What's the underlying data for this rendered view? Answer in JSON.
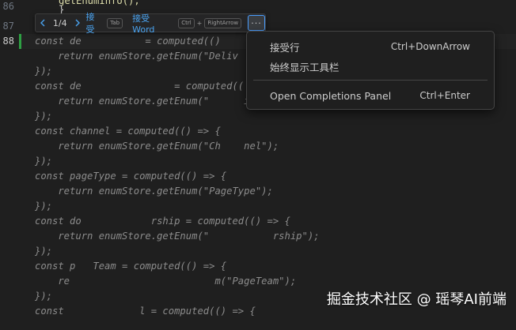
{
  "gutter": {
    "line_numbers": [
      "86",
      "87",
      "88"
    ]
  },
  "top_fragment": {
    "line1": "getEnumInfo();",
    "line2": "}"
  },
  "toolbar": {
    "prev_icon": "chevron-left-icon",
    "next_icon": "chevron-right-icon",
    "counter": "1/4",
    "accept_label": "接受",
    "accept_key": "Tab",
    "accept_word_label": "接受 Word",
    "accept_word_key1": "Ctrl",
    "accept_word_plus": "+",
    "accept_word_key2": "RightArrow",
    "more_label": "···"
  },
  "menu": {
    "items": [
      {
        "label": "接受行",
        "shortcut": "Ctrl+DownArrow"
      },
      {
        "label": "始终显示工具栏",
        "shortcut": ""
      },
      {
        "label": "Open Completions Panel",
        "shortcut": "Ctrl+Enter"
      }
    ]
  },
  "code": {
    "lines": [
      "const de           = computed(()",
      "    return enumStore.getEnum(\"Deliv",
      "});",
      "const de                = computed((",
      "    return enumStore.getEnum(\"      iv",
      "});",
      "const channel = computed(() => {",
      "    return enumStore.getEnum(\"Ch    nel\");",
      "});",
      "const pageType = computed(() => {",
      "    return enumStore.getEnum(\"PageType\");",
      "});",
      "const do            rship = computed(() => {",
      "    return enumStore.getEnum(\"           rship\");",
      "});",
      "const p   Team = computed(() => {",
      "    re                         m(\"PageTeam\");",
      "});",
      "const             l = computed(() => {"
    ]
  },
  "watermark": "掘金技术社区 @ 瑶琴AI前端"
}
